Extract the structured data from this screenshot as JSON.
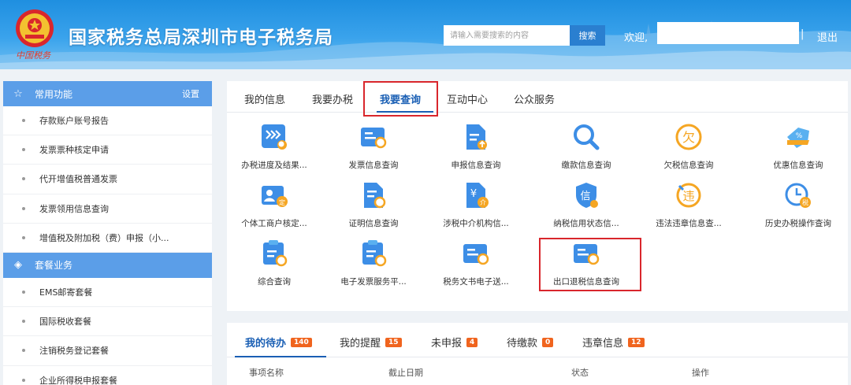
{
  "header": {
    "title": "国家税务总局深圳市电子税务局",
    "signature": "中国税务",
    "search_placeholder": "请输入需要搜索的内容",
    "search_label": "搜索",
    "welcome": "欢迎,",
    "separator": "|",
    "logout": "退出"
  },
  "sidebar": {
    "common": {
      "title": "常用功能",
      "setting": "设置",
      "items": [
        "存款账户账号报告",
        "发票票种核定申请",
        "代开增值税普通发票",
        "发票领用信息查询",
        "增值税及附加税（费）申报（小..."
      ]
    },
    "package": {
      "title": "套餐业务",
      "items": [
        "EMS邮寄套餐",
        "国际税收套餐",
        "注销税务登记套餐",
        "企业所得税申报套餐"
      ]
    }
  },
  "tabs": [
    "我的信息",
    "我要办税",
    "我要查询",
    "互动中心",
    "公众服务"
  ],
  "grid": {
    "row1": [
      "办税进度及结果...",
      "发票信息查询",
      "申报信息查询",
      "缴款信息查询",
      "欠税信息查询",
      "优惠信息查询"
    ],
    "row2": [
      "个体工商户核定...",
      "证明信息查询",
      "涉税中介机构信...",
      "纳税信用状态信...",
      "违法违章信息查...",
      "历史办税操作查询"
    ],
    "row3": [
      "综合查询",
      "电子发票服务平...",
      "税务文书电子送...",
      "出口退税信息查询"
    ]
  },
  "icon_glyphs": {
    "owed": "欠",
    "discount": "%",
    "credit": "信",
    "violation": "违",
    "history": "税",
    "agency": "¥",
    "agency_sub": "介",
    "individual": "定"
  },
  "todo": {
    "tabs": [
      {
        "label": "我的待办",
        "count": "140"
      },
      {
        "label": "我的提醒",
        "count": "15"
      },
      {
        "label": "未申报",
        "count": "4"
      },
      {
        "label": "待缴款",
        "count": "0"
      },
      {
        "label": "违章信息",
        "count": "12"
      }
    ],
    "headers": [
      "事项名称",
      "截止日期",
      "状态",
      "操作"
    ]
  },
  "colors": {
    "header_blue": "#1f8fe0",
    "sidebar_head": "#5b9ee8",
    "active_tab": "#1a5fb4",
    "highlight": "#d9262c",
    "badge": "#f0641e",
    "icon_blue": "#3d8ee6",
    "icon_orange": "#f5a623"
  }
}
